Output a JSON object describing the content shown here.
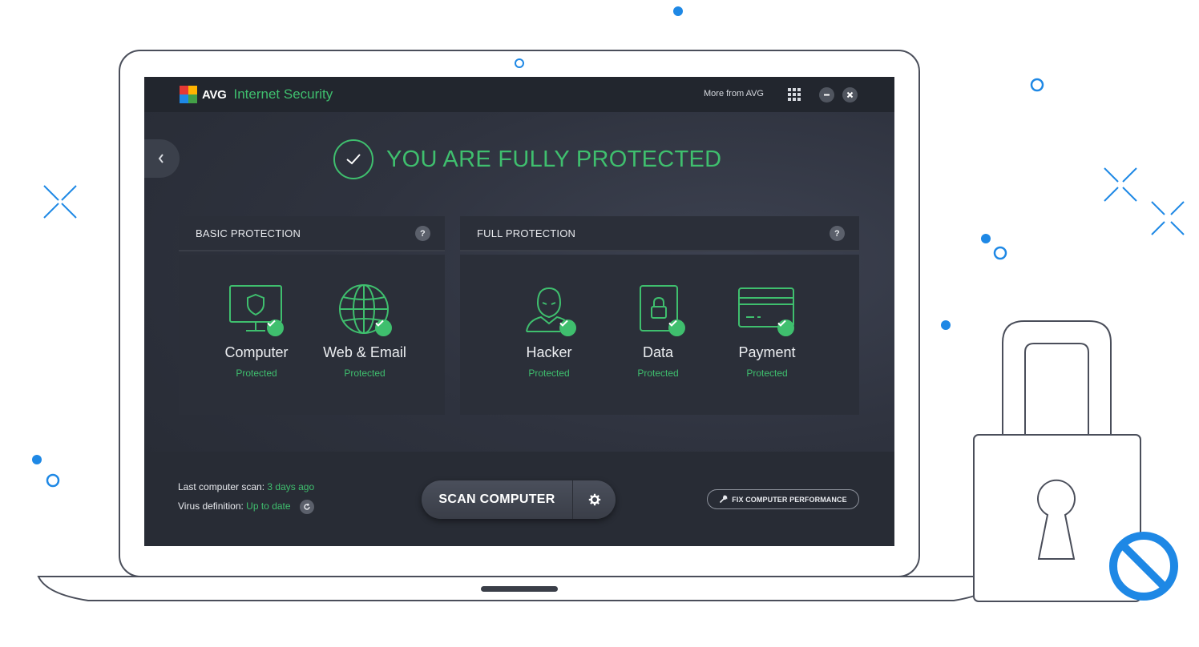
{
  "brand": {
    "name": "AVG",
    "product": "Internet Security",
    "logo_colors": [
      "#e53935",
      "#ffb300",
      "#1e88e5",
      "#43a047"
    ]
  },
  "titlebar": {
    "more_from": "More from AVG",
    "menu_icon": "apps-grid-icon",
    "minimize_icon": "minimize-icon",
    "close_icon": "close-icon"
  },
  "nav": {
    "back_icon": "chevron-left-icon"
  },
  "status": {
    "icon": "check-circle-icon",
    "text": "YOU ARE FULLY PROTECTED"
  },
  "panels": {
    "basic": {
      "title": "BASIC PROTECTION",
      "help": "?",
      "items": [
        {
          "name": "Computer",
          "state": "Protected",
          "icon": "monitor-shield-icon"
        },
        {
          "name": "Web & Email",
          "state": "Protected",
          "icon": "globe-icon"
        }
      ]
    },
    "full": {
      "title": "FULL PROTECTION",
      "help": "?",
      "items": [
        {
          "name": "Hacker",
          "state": "Protected",
          "icon": "hacker-icon"
        },
        {
          "name": "Data",
          "state": "Protected",
          "icon": "locked-file-icon"
        },
        {
          "name": "Payment",
          "state": "Protected",
          "icon": "credit-card-icon"
        }
      ]
    }
  },
  "footer": {
    "last_scan_label": "Last computer scan:",
    "last_scan_value": "3 days ago",
    "virus_def_label": "Virus definition:",
    "virus_def_value": "Up to date",
    "refresh_icon": "refresh-icon",
    "scan_button": "SCAN COMPUTER",
    "scan_settings_icon": "gear-icon",
    "fix_button": "FIX COMPUTER PERFORMANCE",
    "fix_icon": "wrench-icon"
  },
  "colors": {
    "accent_green": "#3fbf6e",
    "decor_blue": "#1e88e5",
    "window_dark": "#2f333f"
  }
}
